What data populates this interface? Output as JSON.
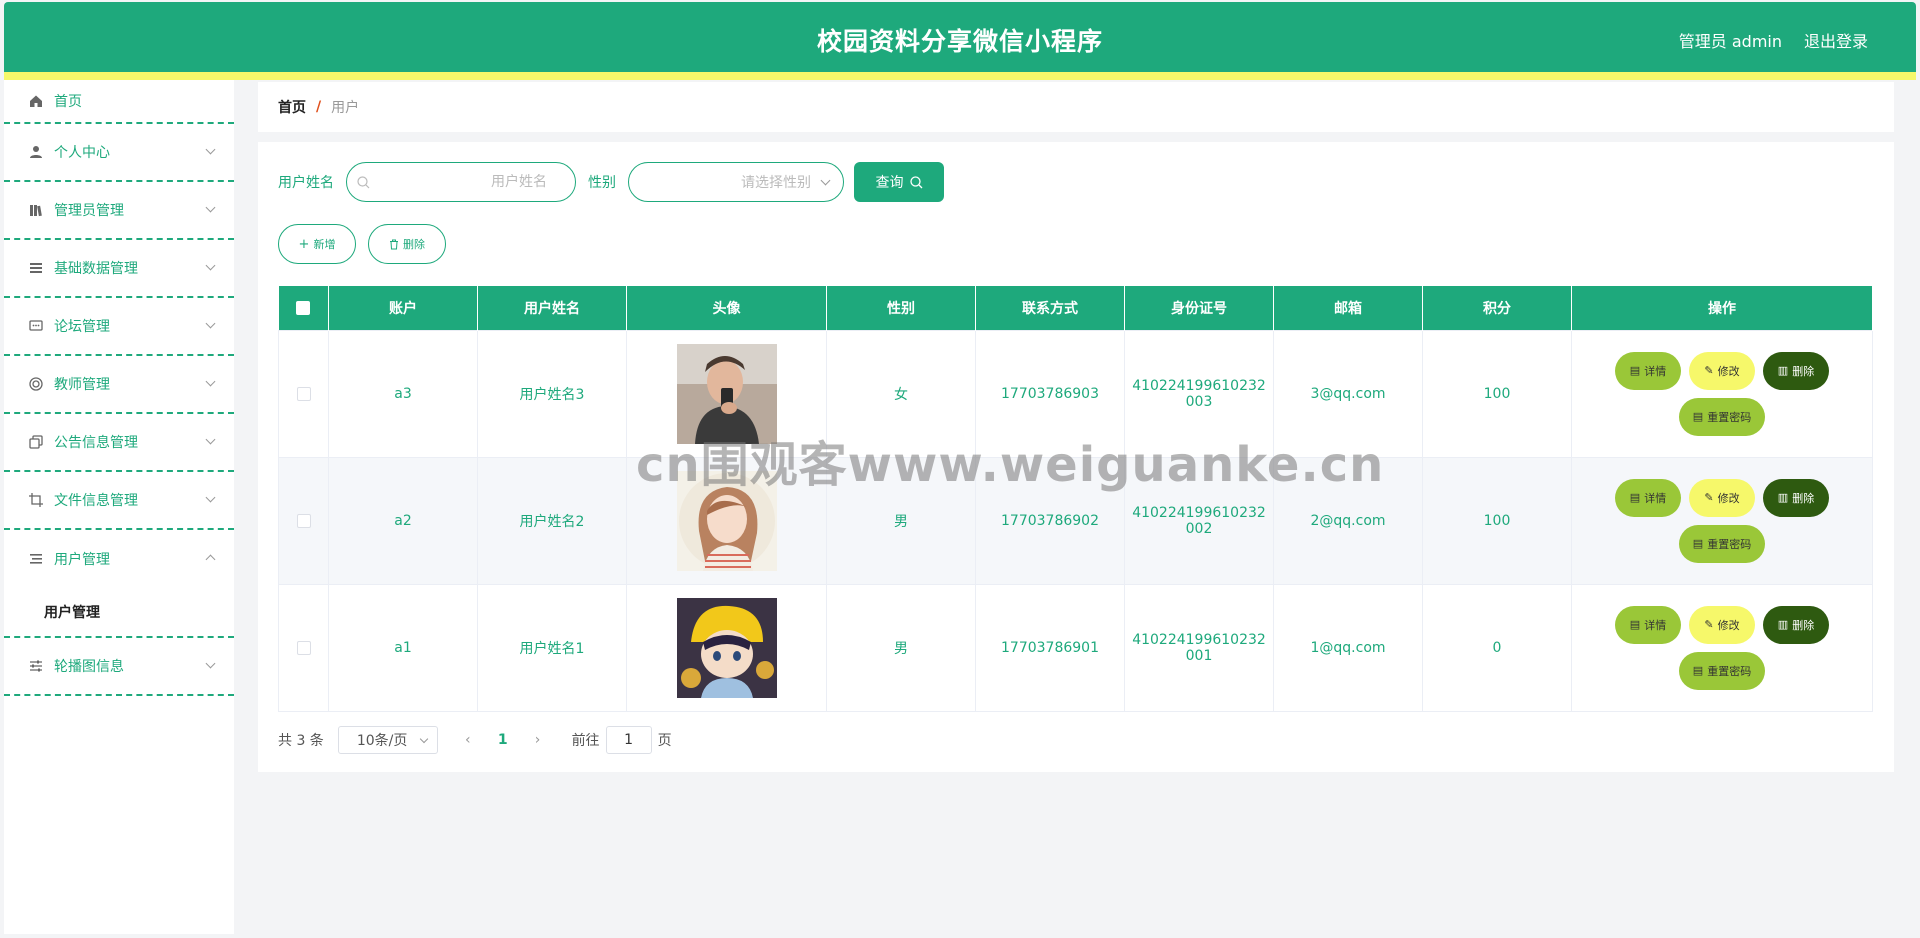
{
  "header": {
    "title": "校园资料分享微信小程序",
    "user": "管理员 admin",
    "logout": "退出登录"
  },
  "sidebar": {
    "items": [
      {
        "label": "首页",
        "icon": "home-icon"
      },
      {
        "label": "个人中心",
        "icon": "person-icon"
      },
      {
        "label": "管理员管理",
        "icon": "books-icon"
      },
      {
        "label": "基础数据管理",
        "icon": "list-icon"
      },
      {
        "label": "论坛管理",
        "icon": "chat-icon"
      },
      {
        "label": "教师管理",
        "icon": "target-icon"
      },
      {
        "label": "公告信息管理",
        "icon": "copy-icon"
      },
      {
        "label": "文件信息管理",
        "icon": "crop-icon"
      },
      {
        "label": "用户管理",
        "icon": "menu-icon",
        "expanded": true
      },
      {
        "label": "轮播图信息",
        "icon": "sliders-icon"
      }
    ],
    "sub_user": "用户管理"
  },
  "breadcrumb": {
    "home": "首页",
    "sep": "/",
    "current": "用户"
  },
  "search": {
    "name_label": "用户姓名",
    "name_placeholder": "用户姓名",
    "gender_label": "性别",
    "gender_placeholder": "请选择性别",
    "query": "查询"
  },
  "actions": {
    "add": "新增",
    "delete": "删除"
  },
  "table": {
    "headers": [
      "账户",
      "用户姓名",
      "头像",
      "性别",
      "联系方式",
      "身份证号",
      "邮箱",
      "积分",
      "操作"
    ],
    "rows": [
      {
        "account": "a3",
        "name": "用户姓名3",
        "gender": "女",
        "phone": "17703786903",
        "id_a": "410224199610232",
        "id_b": "003",
        "email": "3@qq.com",
        "points": "100"
      },
      {
        "account": "a2",
        "name": "用户姓名2",
        "gender": "男",
        "phone": "17703786902",
        "id_a": "410224199610232",
        "id_b": "002",
        "email": "2@qq.com",
        "points": "100"
      },
      {
        "account": "a1",
        "name": "用户姓名1",
        "gender": "男",
        "phone": "17703786901",
        "id_a": "410224199610232",
        "id_b": "001",
        "email": "1@qq.com",
        "points": "0"
      }
    ],
    "ops": {
      "detail": "详情",
      "edit": "修改",
      "delete": "删除",
      "reset": "重置密码"
    }
  },
  "pagination": {
    "total": "共 3 条",
    "size": "10条/页",
    "page": "1",
    "goto": "前往",
    "jump_value": "1",
    "page_unit": "页"
  },
  "watermark": "cn围观客www.weiguanke.cn",
  "colors": {
    "primary": "#1ea97c",
    "stripe": "#f6f86a",
    "detail": "#9ac738",
    "edit": "#f6f86a",
    "delete": "#2e5a10"
  }
}
